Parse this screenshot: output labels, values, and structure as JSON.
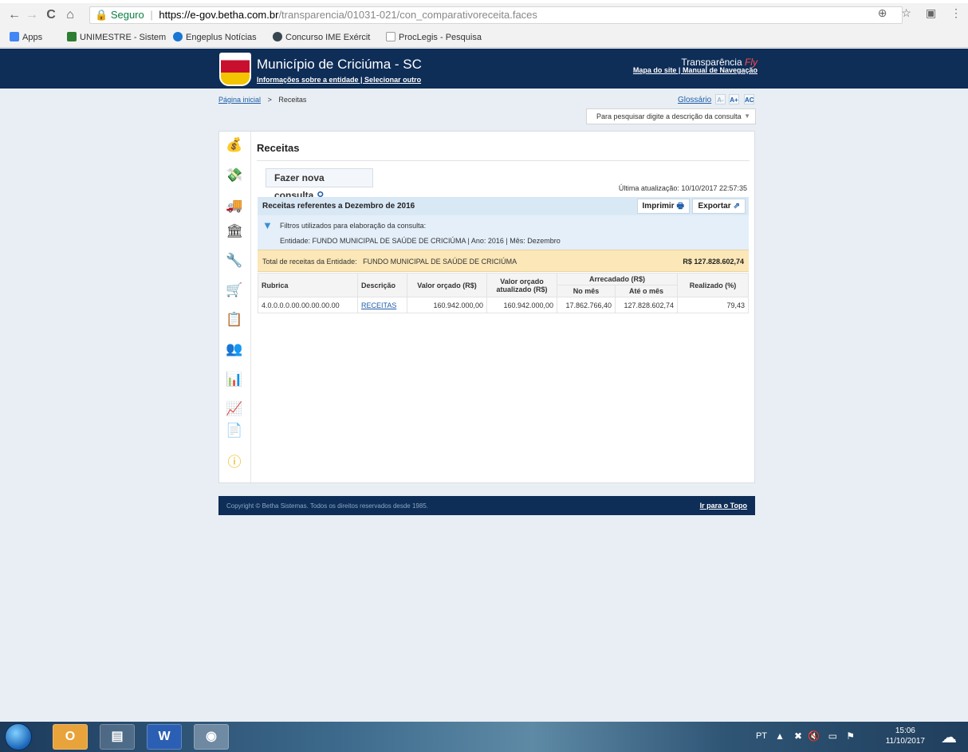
{
  "browser": {
    "back": "←",
    "forward": "→",
    "reload": "C",
    "home": "⌂",
    "secure_label": "Seguro",
    "url_host": "https://e-gov.betha.com.br",
    "url_path": "/transparencia/01031-021/con_comparativoreceita.faces",
    "bookmarks": [
      {
        "label": "Apps",
        "color": "#4285f4"
      },
      {
        "label": "UNIMESTRE - Sistem",
        "color": "#2e7d32"
      },
      {
        "label": "Engeplus Notícias",
        "color": "#1976d2"
      },
      {
        "label": "Concurso IME Exércit",
        "color": "#37474f"
      },
      {
        "label": "ProcLegis - Pesquisa",
        "color": "#9e9e9e"
      }
    ]
  },
  "header": {
    "municipality": "Município de Criciúma - SC",
    "links": "Informações sobre a entidade | Selecionar outro",
    "brand": "Transparência",
    "brand_accent": "Fly",
    "brand_links": "Mapa do site | Manual de Navegação"
  },
  "breadcrumb": {
    "home": "Página inicial",
    "sep": ">",
    "current": "Receitas"
  },
  "tools": {
    "glossary": "Glossário",
    "font_smaller": "A-",
    "font_larger": "A+",
    "contrast": "AC",
    "search_placeholder": "Para pesquisar digite a descrição da consulta"
  },
  "main": {
    "title": "Receitas",
    "new_query": "Fazer nova consulta",
    "last_update": "Última atualização: 10/10/2017 22:57:35",
    "report_title": "Receitas referentes a Dezembro de 2016",
    "print": "Imprimir",
    "export": "Exportar",
    "filters_label": "Filtros utilizados para elaboração da consulta:",
    "filters_value": "Entidade: FUNDO MUNICIPAL DE SAÚDE DE CRICIÚMA | Ano: 2016 | Mês: Dezembro",
    "total_label": "Total de receitas da Entidade:",
    "total_entity": "FUNDO MUNICIPAL DE SAÚDE DE CRICIÚMA",
    "total_value": "R$ 127.828.602,74"
  },
  "table": {
    "headers": {
      "rubrica": "Rubrica",
      "descricao": "Descrição",
      "orcado": "Valor orçado (R$)",
      "orcado_atual": "Valor orçado atualizado (R$)",
      "arrecadado": "Arrecadado (R$)",
      "no_mes": "No mês",
      "ate_mes": "Até o mês",
      "realizado": "Realizado (%)"
    },
    "rows": [
      {
        "rubrica": "4.0.0.0.0.00.00.00.00.00",
        "descricao": "RECEITAS",
        "orcado": "160.942.000,00",
        "orcado_atual": "160.942.000,00",
        "no_mes": "17.862.766,40",
        "ate_mes": "127.828.602,74",
        "realizado": "79,43"
      }
    ]
  },
  "footer": {
    "copyright": "Copyright © Betha Sistemas. Todos os direitos reservados desde 1985.",
    "top_link": "Ir para o Topo"
  },
  "taskbar": {
    "lang": "PT",
    "time": "15:06",
    "date": "11/10/2017"
  }
}
